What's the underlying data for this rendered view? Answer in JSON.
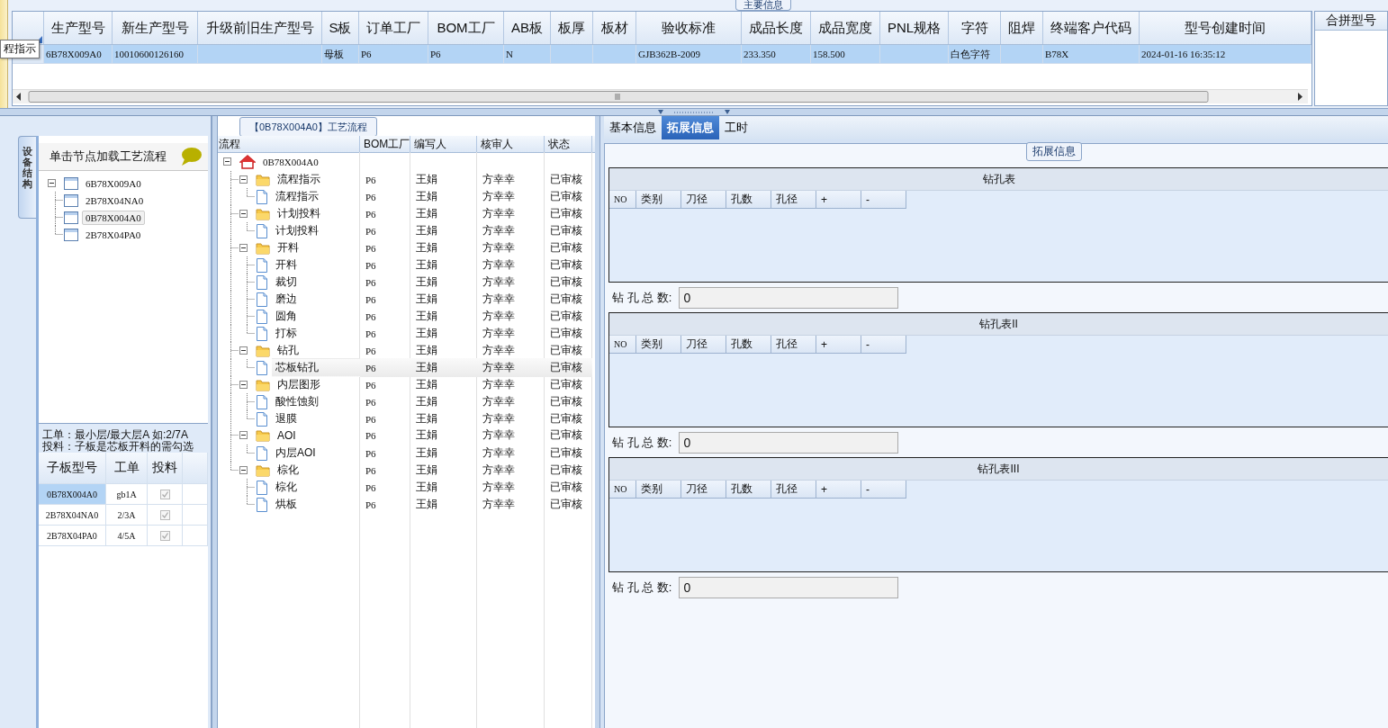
{
  "main_info": {
    "group_title": "主要信息",
    "tooltip": "程指示",
    "columns": [
      "生产型号",
      "新生产型号",
      "升级前旧生产型号",
      "S板",
      "订单工厂",
      "BOM工厂",
      "AB板",
      "板厚",
      "板材",
      "验收标准",
      "成品长度",
      "成品宽度",
      "PNL规格",
      "字符",
      "阻焊",
      "终端客户代码",
      "型号创建时间"
    ],
    "rows": [
      {
        "selected": true,
        "cells": [
          "6B78X009A0",
          "10010600126160",
          null,
          "母板",
          "P6",
          "P6",
          "N",
          null,
          null,
          "GJB362B-2009",
          "233.350",
          "158.500",
          null,
          "白色字符",
          null,
          "B78X",
          "2024-01-16 16:35:12"
        ]
      }
    ],
    "side_header": "合拼型号"
  },
  "structure": {
    "tab_label": "设备结构",
    "hint": "单击节点加载工艺流程",
    "tree": [
      {
        "label": "6B78X009A0",
        "expanded": true,
        "selected": false,
        "children": [
          {
            "label": "2B78X04NA0",
            "selected": false
          },
          {
            "label": "0B78X004A0",
            "selected": true
          },
          {
            "label": "2B78X04PA0",
            "selected": false
          }
        ]
      }
    ],
    "note_lines": [
      "工单：最小层/最大层A 如:2/7A",
      "投料：子板是芯板开料的需勾选"
    ],
    "sub_grid": {
      "columns": [
        "子板型号",
        "工单",
        "投料"
      ],
      "rows": [
        {
          "board": "0B78X004A0",
          "order": "gb1A",
          "feed": true,
          "selected": true
        },
        {
          "board": "2B78X04NA0",
          "order": "2/3A",
          "feed": true,
          "selected": false
        },
        {
          "board": "2B78X04PA0",
          "order": "4/5A",
          "feed": true,
          "selected": false
        }
      ]
    }
  },
  "process": {
    "title": "【0B78X004A0】工艺流程",
    "columns": [
      "流程",
      "BOM工厂",
      "编写人",
      "核审人",
      "状态"
    ],
    "tree": [
      {
        "label": "0B78X004A0",
        "kind": "home",
        "expanded": true,
        "selected": false,
        "children": [
          {
            "label": "流程指示",
            "kind": "folder",
            "expanded": true,
            "selected": false,
            "bom": "P6",
            "writer": "王娟",
            "reviewer": "方幸幸",
            "status": "已审核",
            "children": [
              {
                "label": "流程指示",
                "kind": "step",
                "selected": false,
                "bom": "P6",
                "writer": "王娟",
                "reviewer": "方幸幸",
                "status": "已审核"
              }
            ]
          },
          {
            "label": "计划投料",
            "kind": "folder",
            "expanded": true,
            "selected": false,
            "bom": "P6",
            "writer": "王娟",
            "reviewer": "方幸幸",
            "status": "已审核",
            "children": [
              {
                "label": "计划投料",
                "kind": "step",
                "selected": false,
                "bom": "P6",
                "writer": "王娟",
                "reviewer": "方幸幸",
                "status": "已审核"
              }
            ]
          },
          {
            "label": "开料",
            "kind": "folder",
            "expanded": true,
            "selected": false,
            "bom": "P6",
            "writer": "王娟",
            "reviewer": "方幸幸",
            "status": "已审核",
            "children": [
              {
                "label": "开料",
                "kind": "step",
                "selected": false,
                "bom": "P6",
                "writer": "王娟",
                "reviewer": "方幸幸",
                "status": "已审核"
              },
              {
                "label": "裁切",
                "kind": "step",
                "selected": false,
                "bom": "P6",
                "writer": "王娟",
                "reviewer": "方幸幸",
                "status": "已审核"
              },
              {
                "label": "磨边",
                "kind": "step",
                "selected": false,
                "bom": "P6",
                "writer": "王娟",
                "reviewer": "方幸幸",
                "status": "已审核"
              },
              {
                "label": "圆角",
                "kind": "step",
                "selected": false,
                "bom": "P6",
                "writer": "王娟",
                "reviewer": "方幸幸",
                "status": "已审核"
              },
              {
                "label": "打标",
                "kind": "step",
                "selected": false,
                "bom": "P6",
                "writer": "王娟",
                "reviewer": "方幸幸",
                "status": "已审核"
              }
            ]
          },
          {
            "label": "钻孔",
            "kind": "folder",
            "expanded": true,
            "selected": false,
            "bom": "P6",
            "writer": "王娟",
            "reviewer": "方幸幸",
            "status": "已审核",
            "children": [
              {
                "label": "芯板钻孔",
                "kind": "step",
                "selected": true,
                "bom": "P6",
                "writer": "王娟",
                "reviewer": "方幸幸",
                "status": "已审核"
              }
            ]
          },
          {
            "label": "内层图形",
            "kind": "folder",
            "expanded": true,
            "selected": false,
            "bom": "P6",
            "writer": "王娟",
            "reviewer": "方幸幸",
            "status": "已审核",
            "children": [
              {
                "label": "酸性蚀刻",
                "kind": "step",
                "selected": false,
                "bom": "P6",
                "writer": "王娟",
                "reviewer": "方幸幸",
                "status": "已审核"
              },
              {
                "label": "退膜",
                "kind": "step",
                "selected": false,
                "bom": "P6",
                "writer": "王娟",
                "reviewer": "方幸幸",
                "status": "已审核"
              }
            ]
          },
          {
            "label": "AOI",
            "kind": "folder",
            "expanded": true,
            "selected": false,
            "bom": "P6",
            "writer": "王娟",
            "reviewer": "方幸幸",
            "status": "已审核",
            "children": [
              {
                "label": "内层AOI",
                "kind": "step",
                "selected": false,
                "bom": "P6",
                "writer": "王娟",
                "reviewer": "方幸幸",
                "status": "已审核"
              }
            ]
          },
          {
            "label": "棕化",
            "kind": "folder",
            "expanded": true,
            "selected": false,
            "bom": "P6",
            "writer": "王娟",
            "reviewer": "方幸幸",
            "status": "已审核",
            "children": [
              {
                "label": "棕化",
                "kind": "step",
                "selected": false,
                "bom": "P6",
                "writer": "王娟",
                "reviewer": "方幸幸",
                "status": "已审核"
              },
              {
                "label": "烘板",
                "kind": "step",
                "selected": false,
                "bom": "P6",
                "writer": "王娟",
                "reviewer": "方幸幸",
                "status": "已审核"
              }
            ]
          }
        ]
      }
    ]
  },
  "details": {
    "tabs": [
      {
        "label": "基本信息",
        "selected": false
      },
      {
        "label": "拓展信息",
        "selected": true
      },
      {
        "label": "工时",
        "selected": false
      }
    ],
    "group_title": "拓展信息",
    "drill_tables": [
      {
        "title": "钻孔表",
        "columns": [
          "NO",
          "类别",
          "刀径",
          "孔数",
          "孔径",
          "+",
          "-"
        ],
        "total_label": "钻 孔 总 数:",
        "total": "0"
      },
      {
        "title": "钻孔表II",
        "columns": [
          "NO",
          "类别",
          "刀径",
          "孔数",
          "孔径",
          "+",
          "-"
        ],
        "total_label": "钻 孔 总 数:",
        "total": "0"
      },
      {
        "title": "钻孔表III",
        "columns": [
          "NO",
          "类别",
          "刀径",
          "孔数",
          "孔径",
          "+",
          "-"
        ],
        "total_label": "钻 孔 总 数:",
        "total": "0"
      }
    ]
  }
}
